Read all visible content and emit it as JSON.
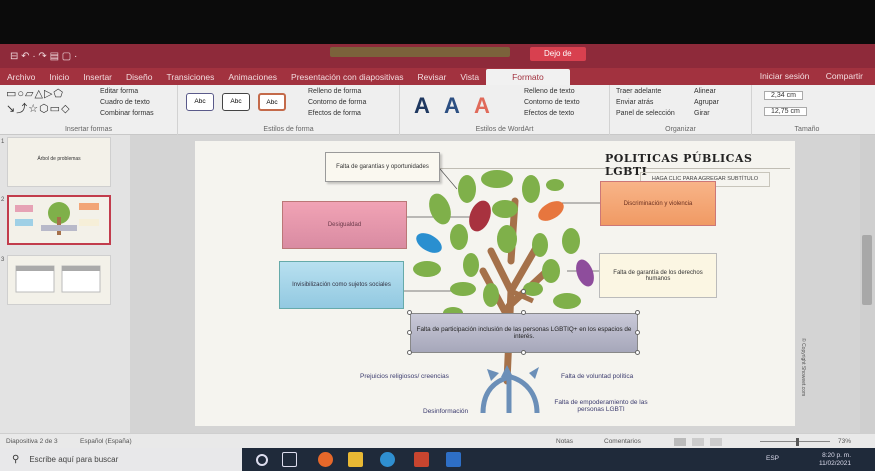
{
  "titlebar": {
    "doc_title": "",
    "sheet_badge": "Dejo de",
    "quick_access": "⊟  ↶ · ↷  ▤  ▢  ·"
  },
  "tabs": [
    "Archivo",
    "Inicio",
    "Insertar",
    "Diseño",
    "Transiciones",
    "Animaciones",
    "Presentación con diapositivas",
    "Revisar",
    "Vista",
    "Formato"
  ],
  "tabs_right": [
    "Iniciar sesión",
    "Compartir"
  ],
  "ribbon": {
    "insert_shapes": {
      "edit_shape": "Editar forma",
      "text_box": "Cuadro de texto",
      "merge_shapes": "Combinar formas",
      "group_label": "Insertar formas"
    },
    "shape_styles": {
      "fill": "Relleno de forma",
      "outline": "Contorno de forma",
      "effects": "Efectos de forma",
      "abc": "Abc",
      "group_label": "Estilos de forma"
    },
    "wordart": {
      "letter": "A",
      "text_fill": "Relleno de texto",
      "text_outline": "Contorno de texto",
      "text_effects": "Efectos de texto",
      "group_label": "Estilos de WordArt"
    },
    "arrange": {
      "bring_forward": "Traer adelante",
      "send_backward": "Enviar atrás",
      "selection_pane": "Panel de selección",
      "align": "Alinear",
      "group": "Agrupar",
      "rotate": "Girar",
      "group_label": "Organizar"
    },
    "size": {
      "height": "2,34 cm",
      "width": "12,75 cm",
      "group_label": "Tamaño"
    }
  },
  "thumbnails": [
    {
      "num": "1",
      "text": "Árbol de problemas"
    },
    {
      "num": "2",
      "text": ""
    },
    {
      "num": "3",
      "text": ""
    }
  ],
  "slide": {
    "title": "POLITICAS PÚBLICAS LGBTI",
    "subtitle": "HAGA CLIC PARA AGREGAR SUBTÍTULO",
    "side_text": "© Copyright Showeet.com",
    "box_top": "Falta de garantías y oportunidades",
    "box_left1": "Desigualdad",
    "box_left2": "Invisibilización como sujetos sociales",
    "box_right1": "Discriminación y violencia",
    "box_right2": "Falta de garantía de los derechos humanos",
    "box_center": "Falta de participación inclusión de las personas LGBTIQ+ en los espacios de interés.",
    "label_prejuicios": "Prejuicios religiosos/ creencias",
    "label_voluntad": "Falta de voluntad política",
    "label_desinfo": "Desinformación",
    "label_empoder": "Falta de empoderamiento de las personas LGBTI"
  },
  "status": {
    "slide_count": "Diapositiva 2 de 3",
    "language": "Español (España)",
    "notes": "Notas",
    "comments": "Comentarios",
    "zoom": "73%"
  },
  "taskbar": {
    "search_placeholder": "Escribe aquí para buscar",
    "tray_lang": "ESP",
    "time": "8:20 p. m.",
    "date": "11/02/2021"
  },
  "colors": {
    "accent": "#a2323f",
    "leaf_green": "#7fb04a",
    "leaf_red": "#a8323f",
    "leaf_orange": "#e7763e",
    "leaf_blue": "#2a8fd0",
    "leaf_purple": "#8e4d9c",
    "trunk": "#a5714a"
  }
}
